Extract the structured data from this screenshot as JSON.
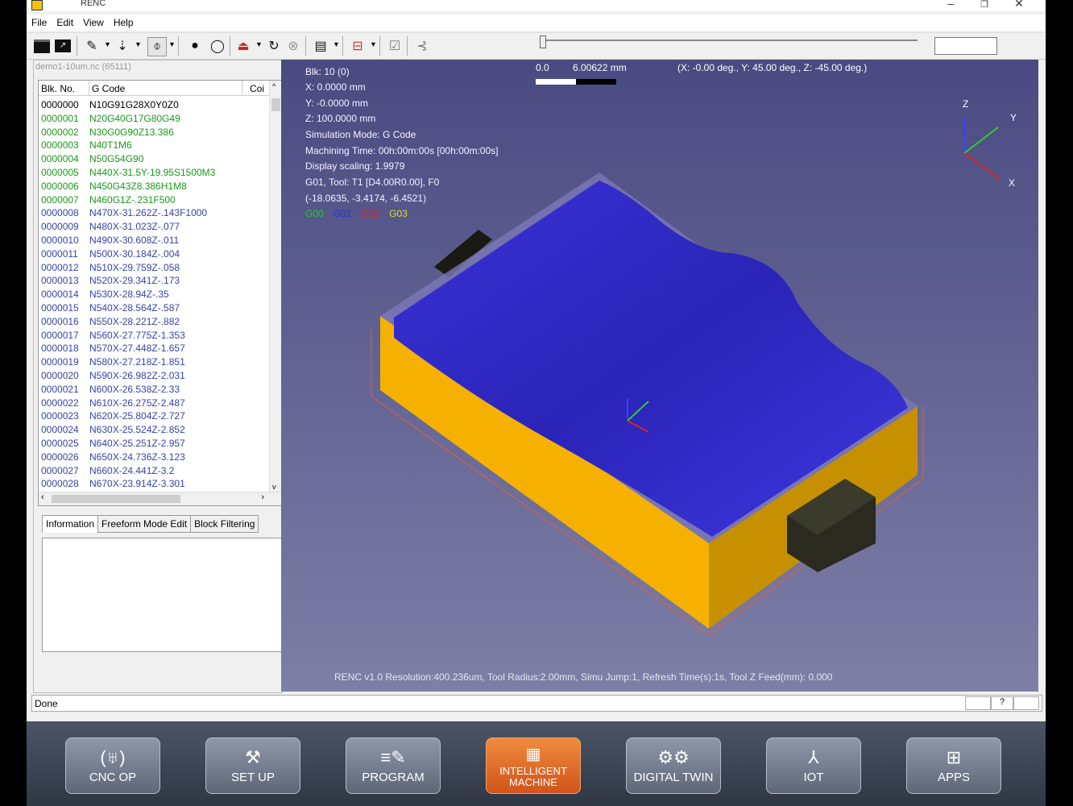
{
  "window": {
    "title": "RENC"
  },
  "menu": [
    "File",
    "Edit",
    "View",
    "Help"
  ],
  "toolbar": {
    "icons": [
      "open-icon",
      "save-icon",
      "edit-icon",
      "tool-icon",
      "clip-icon",
      "light-icon",
      "comment-icon",
      "machine-icon",
      "reset-icon",
      "stop-icon",
      "display-icon",
      "layer-icon",
      "check-icon",
      "step-icon"
    ]
  },
  "file": {
    "label": "demo1-10um.nc (65111)"
  },
  "gcode": {
    "headers": [
      "Blk. No.",
      "G Code",
      "Coi"
    ],
    "rows": [
      {
        "blk": "0000000",
        "code": "N10G91G28X0Y0Z0",
        "color": "#000000"
      },
      {
        "blk": "0000001",
        "code": "N20G40G17G80G49",
        "color": "#1a9a1a"
      },
      {
        "blk": "0000002",
        "code": "N30G0G90Z13.386",
        "color": "#1a9a1a"
      },
      {
        "blk": "0000003",
        "code": "N40T1M6",
        "color": "#1a9a1a"
      },
      {
        "blk": "0000004",
        "code": "N50G54G90",
        "color": "#1a9a1a"
      },
      {
        "blk": "0000005",
        "code": "N440X-31.5Y-19.95S1500M3",
        "color": "#1a9a1a"
      },
      {
        "blk": "0000006",
        "code": "N450G43Z8.386H1M8",
        "color": "#1a9a1a"
      },
      {
        "blk": "0000007",
        "code": "N460G1Z-.231F500",
        "color": "#1a9a1a"
      },
      {
        "blk": "0000008",
        "code": "N470X-31.262Z-.143F1000",
        "color": "#3344aa"
      },
      {
        "blk": "0000009",
        "code": "N480X-31.023Z-.077",
        "color": "#3344aa"
      },
      {
        "blk": "0000010",
        "code": "N490X-30.608Z-.011",
        "color": "#3344aa"
      },
      {
        "blk": "0000011",
        "code": "N500X-30.184Z-.004",
        "color": "#3344aa"
      },
      {
        "blk": "0000012",
        "code": "N510X-29.759Z-.058",
        "color": "#3344aa"
      },
      {
        "blk": "0000013",
        "code": "N520X-29.341Z-.173",
        "color": "#3344aa"
      },
      {
        "blk": "0000014",
        "code": "N530X-28.94Z-.35",
        "color": "#3344aa"
      },
      {
        "blk": "0000015",
        "code": "N540X-28.564Z-.587",
        "color": "#3344aa"
      },
      {
        "blk": "0000016",
        "code": "N550X-28.221Z-.882",
        "color": "#3344aa"
      },
      {
        "blk": "0000017",
        "code": "N560X-27.775Z-1.353",
        "color": "#3344aa"
      },
      {
        "blk": "0000018",
        "code": "N570X-27.448Z-1.657",
        "color": "#3344aa"
      },
      {
        "blk": "0000019",
        "code": "N580X-27.218Z-1.851",
        "color": "#3344aa"
      },
      {
        "blk": "0000020",
        "code": "N590X-26.982Z-2.031",
        "color": "#3344aa"
      },
      {
        "blk": "0000021",
        "code": "N600X-26.538Z-2.33",
        "color": "#3344aa"
      },
      {
        "blk": "0000022",
        "code": "N610X-26.275Z-2.487",
        "color": "#3344aa"
      },
      {
        "blk": "0000023",
        "code": "N620X-25.804Z-2.727",
        "color": "#3344aa"
      },
      {
        "blk": "0000024",
        "code": "N630X-25.524Z-2.852",
        "color": "#3344aa"
      },
      {
        "blk": "0000025",
        "code": "N640X-25.251Z-2.957",
        "color": "#3344aa"
      },
      {
        "blk": "0000026",
        "code": "N650X-24.736Z-3.123",
        "color": "#3344aa"
      },
      {
        "blk": "0000027",
        "code": "N660X-24.441Z-3.2",
        "color": "#3344aa"
      },
      {
        "blk": "0000028",
        "code": "N670X-23.914Z-3.301",
        "color": "#3344aa"
      }
    ]
  },
  "tabs": [
    "Information",
    "Freeform Mode Edit",
    "Block Filtering"
  ],
  "sim": {
    "blk": "Blk: 10 (0)",
    "x": "X: 0.0000 mm",
    "y": "Y: -0.0000 mm",
    "z": "Z: 100.0000 mm",
    "mode": "Simulation Mode: G Code",
    "time": "Machining Time: 00h:00m:00s [00h:00m:00s]",
    "scaling": "Display scaling: 1.9979",
    "tool": "G01, Tool: T1 [D4.00R0.00], F0",
    "coords": "(-18.0635, -3.4174, -6.4521)",
    "legend": [
      {
        "label": "G00",
        "color": "#22cc22"
      },
      {
        "label": "G01",
        "color": "#2233dd"
      },
      {
        "label": "G02",
        "color": "#dd2222"
      },
      {
        "label": "G03",
        "color": "#dddd22"
      }
    ],
    "scale_start": "0.0",
    "scale_end": "6.00622 mm",
    "angle": "(X: -0.00 deg., Y: 45.00 deg., Z: -45.00 deg.)",
    "axes": {
      "x": "X",
      "y": "Y",
      "z": "Z"
    },
    "footer": "RENC v1.0 Resolution:400.236um, Tool Radius:2.00mm, Simu Jump:1, Refresh Time(s):1s, Tool Z Feed(mm): 0.000"
  },
  "status": {
    "text": "Done",
    "help": "?"
  },
  "dock": [
    {
      "label": "CNC OP",
      "icon": "cnc-op-icon",
      "glyph": "(♅)",
      "active": false
    },
    {
      "label": "SET UP",
      "icon": "setup-tools-icon",
      "glyph": "⚒",
      "active": false
    },
    {
      "label": "PROGRAM",
      "icon": "program-icon",
      "glyph": "≡✎",
      "active": false
    },
    {
      "label": "INTELLIGENT MACHINE",
      "icon": "intelligent-machine-icon",
      "glyph": "▦",
      "active": true
    },
    {
      "label": "DIGITAL TWIN",
      "icon": "robot-arms-icon",
      "glyph": "⚙⚙",
      "active": false
    },
    {
      "label": "IOT",
      "icon": "iot-network-icon",
      "glyph": "⅄",
      "active": false
    },
    {
      "label": "APPS",
      "icon": "apps-grid-icon",
      "glyph": "⊞",
      "active": false
    }
  ]
}
